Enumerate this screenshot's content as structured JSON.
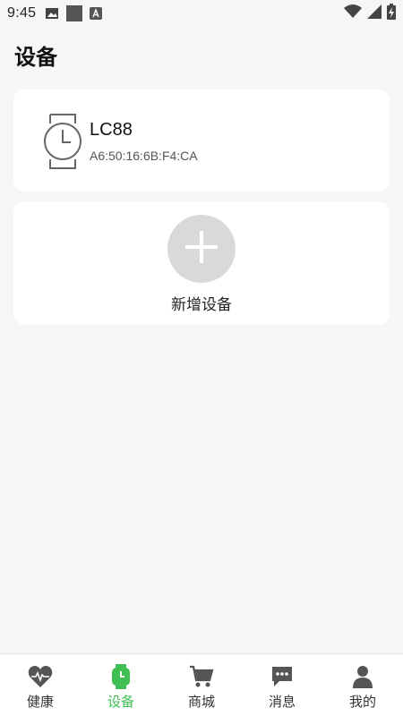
{
  "status": {
    "time": "9:45"
  },
  "page": {
    "title": "设备"
  },
  "device": {
    "name": "LC88",
    "mac": "A6:50:16:6B:F4:CA"
  },
  "add_device": {
    "label": "新增设备"
  },
  "tabs": [
    {
      "label": "健康",
      "icon": "heart-pulse-icon",
      "active": false
    },
    {
      "label": "设备",
      "icon": "watch-icon",
      "active": true
    },
    {
      "label": "商城",
      "icon": "cart-icon",
      "active": false
    },
    {
      "label": "消息",
      "icon": "chat-icon",
      "active": false
    },
    {
      "label": "我的",
      "icon": "user-icon",
      "active": false
    }
  ],
  "colors": {
    "accent": "#3fbf53",
    "icon_gray": "#555555",
    "background": "#f6f6f6"
  }
}
